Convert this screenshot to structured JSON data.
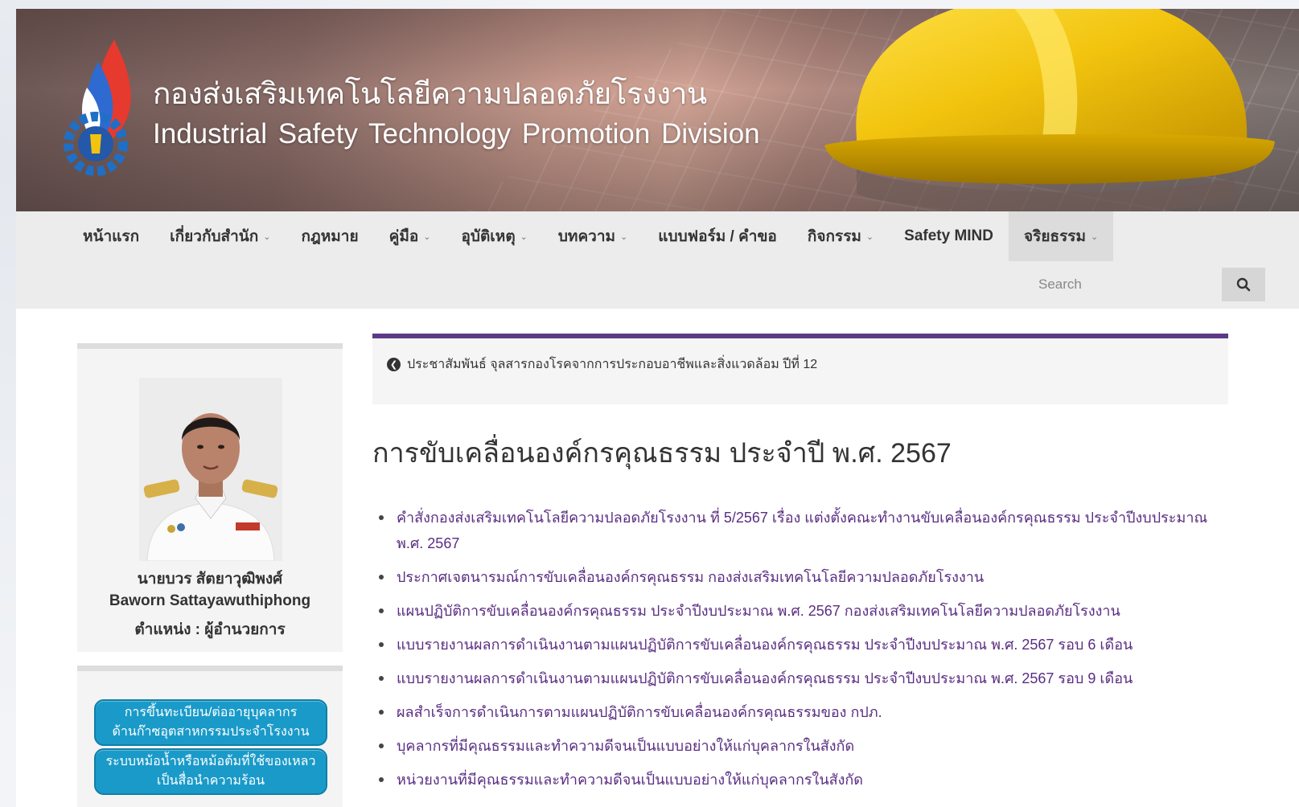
{
  "header": {
    "title_th": "กองส่งเสริมเทคโนโลยีความปลอดภัยโรงงาน",
    "title_en": "Industrial Safety Technology Promotion Division"
  },
  "nav": {
    "items": [
      {
        "label": "หน้าแรก",
        "dropdown": false
      },
      {
        "label": "เกี่ยวกับสำนัก",
        "dropdown": true
      },
      {
        "label": "กฎหมาย",
        "dropdown": false
      },
      {
        "label": "คู่มือ",
        "dropdown": true
      },
      {
        "label": "อุบัติเหตุ",
        "dropdown": true
      },
      {
        "label": "บทความ",
        "dropdown": true
      },
      {
        "label": "แบบฟอร์ม / คำขอ",
        "dropdown": false
      },
      {
        "label": "กิจกรรม",
        "dropdown": true
      },
      {
        "label": "Safety MIND",
        "dropdown": false
      },
      {
        "label": "จริยธรรม",
        "dropdown": true,
        "active": true
      }
    ],
    "search_placeholder": "Search"
  },
  "sidebar": {
    "profile": {
      "name_th": "นายบวร สัตยาวุฒิพงศ์",
      "name_en": "Baworn Sattayawuthiphong",
      "position": "ตำแหน่ง : ผู้อำนวยการ"
    },
    "links": [
      "การขึ้นทะเบียน/ต่ออายุบุคลากร\nด้านก๊าซอุตสาหกรรมประจำโรงงาน",
      "ระบบหม้อน้ำหรือหม้อต้มที่ใช้ของเหลว\nเป็นสื่อนำความร้อน"
    ]
  },
  "main": {
    "breadcrumb": "ประชาสัมพันธ์ จุลสารกองโรคจากการประกอบอาชีพและสิ่งแวดล้อม ปีที่ 12",
    "title": "การขับเคลื่อนองค์กรคุณธรรม ประจำปี พ.ศ. 2567",
    "documents": [
      "คำสั่งกองส่งเสริมเทคโนโลยีความปลอดภัยโรงงาน ที่ 5/2567 เรื่อง แต่งตั้งคณะทำงานขับเคลื่อนองค์กรคุณธรรม ประจำปีงบประมาณ พ.ศ. 2567",
      "ประกาศเจตนารมณ์การขับเคลื่อนองค์กรคุณธรรม กองส่งเสริมเทคโนโลยีความปลอดภัยโรงงาน",
      "แผนปฏิบัติการขับเคลื่อนองค์กรคุณธรรม ประจำปีงบประมาณ พ.ศ. 2567 กองส่งเสริมเทคโนโลยีความปลอดภัยโรงงาน",
      "แบบรายงานผลการดำเนินงานตามแผนปฏิบัติการขับเคลื่อนองค์กรคุณธรรม ประจำปีงบประมาณ พ.ศ. 2567 รอบ 6 เดือน",
      "แบบรายงานผลการดำเนินงานตามแผนปฏิบัติการขับเคลื่อนองค์กรคุณธรรม ประจำปีงบประมาณ พ.ศ. 2567 รอบ 9 เดือน",
      "ผลสำเร็จการดำเนินการตามแผนปฏิบัติการขับเคลื่อนองค์กรคุณธรรมของ กปภ.",
      "บุคลากรที่มีคุณธรรมและทำความดีจนเป็นแบบอย่างให้แก่บุคลากรในสังกัด",
      "หน่วยงานที่มีคุณธรรมและทำความดีจนเป็นแบบอย่างให้แก่บุคลากรในสังกัด"
    ]
  },
  "colors": {
    "accent_purple": "#5c3a86",
    "link_purple": "#5a2d82",
    "sidebar_button": "#1a9ac9",
    "helmet_yellow": "#f2c40f"
  },
  "icons": {
    "search": "search-icon",
    "back": "back-arrow-icon",
    "caret": "chevron-down-icon"
  }
}
